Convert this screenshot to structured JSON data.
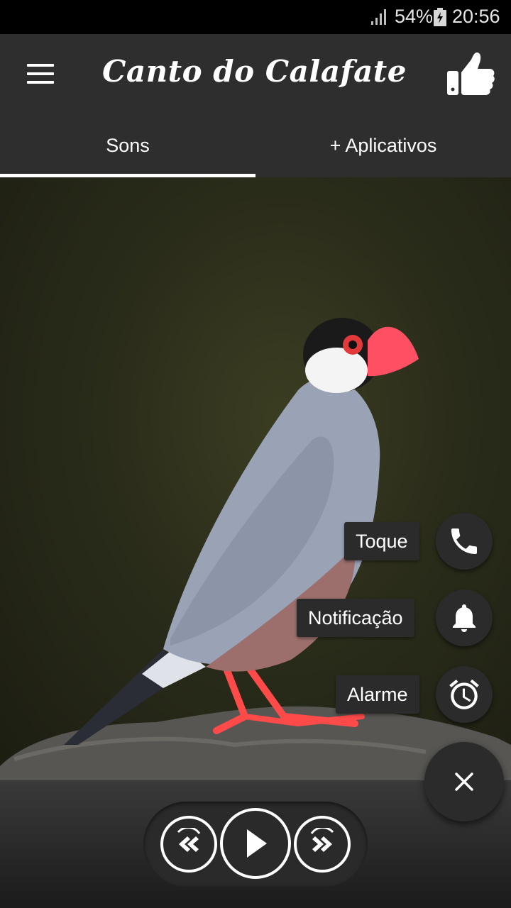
{
  "status_bar": {
    "battery_percent": "54%",
    "time": "20:56",
    "icons": [
      "signal-icon",
      "battery-charging-icon"
    ]
  },
  "app_bar": {
    "title": "Canto do Calafate",
    "icons": [
      "menu-icon",
      "thumbs-up-icon"
    ]
  },
  "tabs": [
    {
      "label": "Sons",
      "selected": true
    },
    {
      "label": "+ Aplicativos",
      "selected": false
    }
  ],
  "fab_menu": {
    "items": [
      {
        "label": "Toque",
        "icon": "phone-icon"
      },
      {
        "label": "Notificação",
        "icon": "bell-icon"
      },
      {
        "label": "Alarme",
        "icon": "alarm-clock-icon"
      }
    ],
    "close_icon": "close-icon"
  },
  "player": {
    "icons": [
      "rewind-icon",
      "play-icon",
      "fast-forward-icon"
    ]
  },
  "colors": {
    "app_bar": "#2e2e2e",
    "status_bar": "#000000",
    "fab": "#2b2b2b",
    "accent": "#ffffff"
  }
}
